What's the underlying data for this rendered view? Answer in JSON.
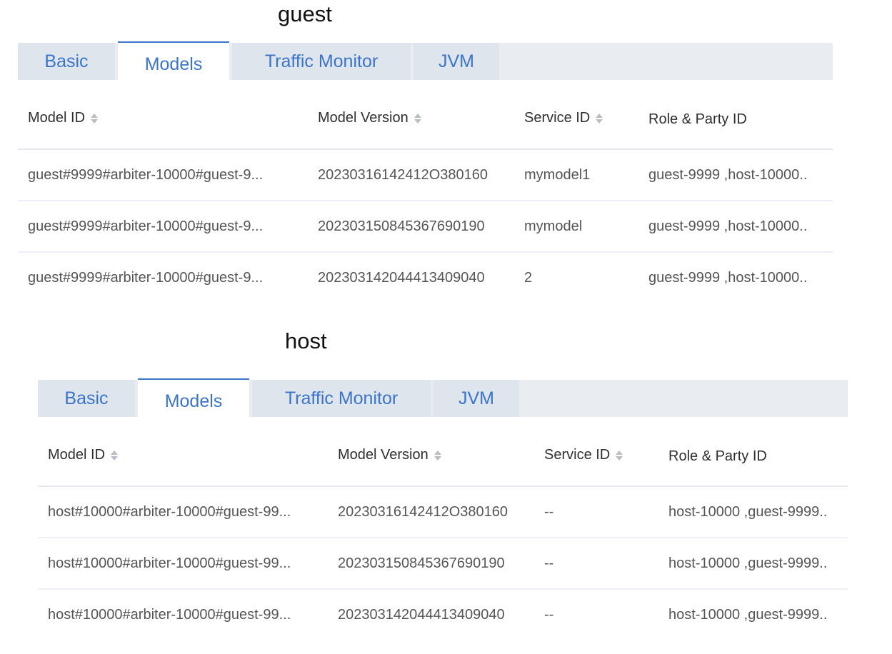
{
  "sections": [
    {
      "title": "guest",
      "tabs": [
        "Basic",
        "Models",
        "Traffic Monitor",
        "JVM"
      ],
      "columns": [
        "Model ID",
        "Model Version",
        "Service ID",
        "Role & Party ID"
      ],
      "rows": [
        [
          "guest#9999#arbiter-10000#guest-9...",
          "20230316142412O380160",
          "mymodel1",
          "guest-9999 ,host-10000.."
        ],
        [
          "guest#9999#arbiter-10000#guest-9...",
          "202303150845367690190",
          "mymodel",
          "guest-9999 ,host-10000.."
        ],
        [
          "guest#9999#arbiter-10000#guest-9...",
          "202303142044413409040",
          "2",
          "guest-9999 ,host-10000.."
        ]
      ]
    },
    {
      "title": "host",
      "tabs": [
        "Basic",
        "Models",
        "Traffic Monitor",
        "JVM"
      ],
      "columns": [
        "Model ID",
        "Model Version",
        "Service ID",
        "Role & Party ID"
      ],
      "rows": [
        [
          "host#10000#arbiter-10000#guest-99...",
          "20230316142412O380160",
          "--",
          "host-10000 ,guest-9999.."
        ],
        [
          "host#10000#arbiter-10000#guest-99...",
          "202303150845367690190",
          "--",
          "host-10000 ,guest-9999.."
        ],
        [
          "host#10000#arbiter-10000#guest-99...",
          "202303142044413409040",
          "--",
          "host-10000 ,guest-9999.."
        ]
      ]
    }
  ]
}
